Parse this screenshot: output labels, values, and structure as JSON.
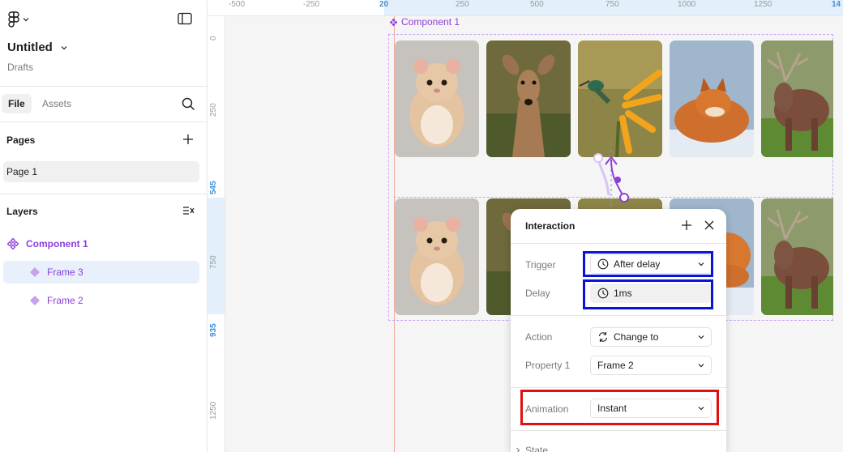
{
  "file": {
    "title": "Untitled",
    "location": "Drafts"
  },
  "tabs": {
    "file": "File",
    "assets": "Assets"
  },
  "pages": {
    "heading": "Pages",
    "items": [
      "Page 1"
    ]
  },
  "layers": {
    "heading": "Layers",
    "items": [
      {
        "label": "Component 1",
        "type": "component"
      },
      {
        "label": "Frame 3",
        "type": "frame",
        "selected": true
      },
      {
        "label": "Frame 2",
        "type": "frame"
      }
    ]
  },
  "ruler": {
    "top": [
      "-500",
      "-250",
      "20",
      "250",
      "500",
      "750",
      "1000",
      "1250",
      "14"
    ],
    "left": [
      "0",
      "250",
      "545",
      "750",
      "935",
      "1250"
    ]
  },
  "canvas": {
    "component_label": "Component 1"
  },
  "interaction": {
    "title": "Interaction",
    "trigger_label": "Trigger",
    "trigger_value": "After delay",
    "delay_label": "Delay",
    "delay_value": "1ms",
    "action_label": "Action",
    "action_value": "Change to",
    "property_label": "Property 1",
    "property_value": "Frame 2",
    "animation_label": "Animation",
    "animation_value": "Instant",
    "state_label": "State"
  },
  "colors": {
    "accent": "#8b3fd9",
    "highlight_blue": "#0a14d8",
    "highlight_red": "#e01010"
  }
}
